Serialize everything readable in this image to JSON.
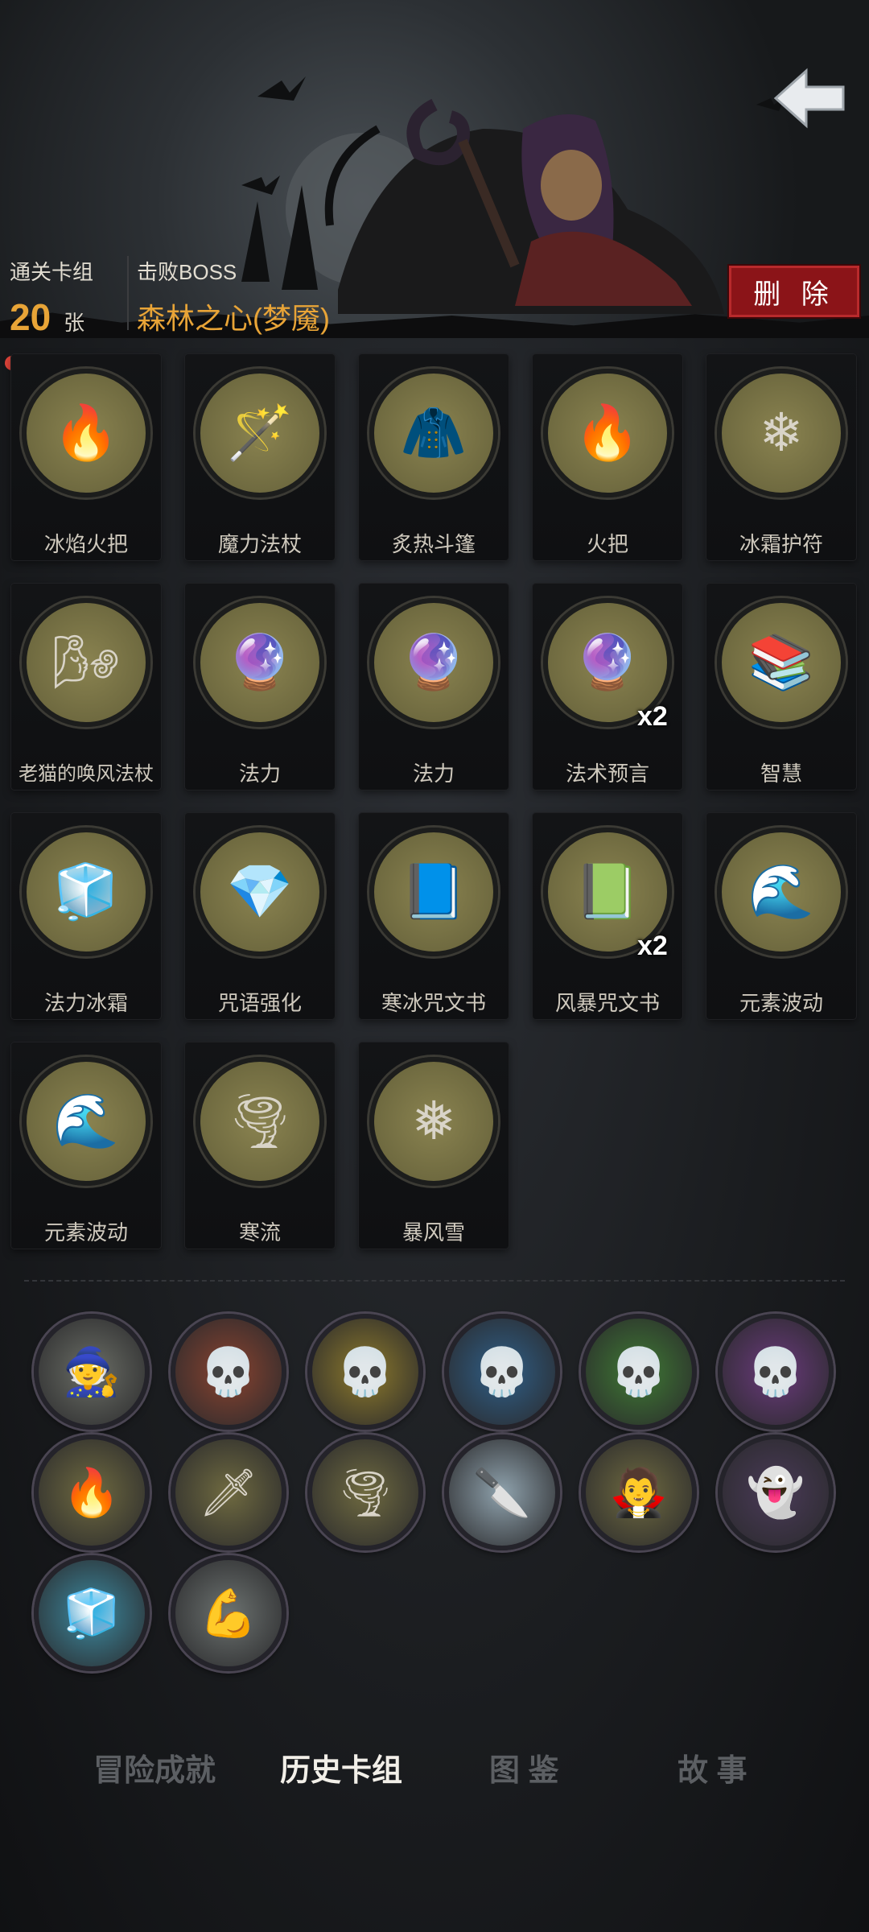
{
  "header": {
    "cleared_deck_label": "通关卡组",
    "card_count": "20",
    "card_unit": "张",
    "defeated_boss_label": "击败BOSS",
    "boss_name": "森林之心(梦魇)",
    "delete_label": "删 除",
    "back_icon": "back-arrow-icon"
  },
  "cards": [
    {
      "name": "冰焰火把",
      "icon": "ice-torch-icon",
      "glyph": "🔥",
      "bg": "#7f7a48"
    },
    {
      "name": "魔力法杖",
      "icon": "magic-staff-icon",
      "glyph": "🪄",
      "bg": "#7f7a48"
    },
    {
      "name": "炙热斗篷",
      "icon": "cloak-icon",
      "glyph": "🧥",
      "bg": "#7f7a48"
    },
    {
      "name": "火把",
      "icon": "torch-icon",
      "glyph": "🔥",
      "bg": "#7f7a48"
    },
    {
      "name": "冰霜护符",
      "icon": "frost-amulet-icon",
      "glyph": "❄",
      "bg": "#7f7a48"
    },
    {
      "name": "老猫的唤风法杖",
      "icon": "wind-staff-icon",
      "glyph": "🌬",
      "bg": "#7f7a48"
    },
    {
      "name": "法力",
      "icon": "mana-orb-icon",
      "glyph": "🔮",
      "bg": "#7f7a48"
    },
    {
      "name": "法力",
      "icon": "mana-orb-icon",
      "glyph": "🔮",
      "bg": "#7f7a48"
    },
    {
      "name": "法术预言",
      "icon": "prophecy-orb-icon",
      "glyph": "🔮",
      "bg": "#7f7a48",
      "multiplier": "x2"
    },
    {
      "name": "智慧",
      "icon": "sage-icon",
      "glyph": "📚",
      "bg": "#7f7a48"
    },
    {
      "name": "法力冰霜",
      "icon": "mana-frost-icon",
      "glyph": "🧊",
      "bg": "#7f7a48"
    },
    {
      "name": "咒语强化",
      "icon": "spell-crystal-icon",
      "glyph": "💎",
      "bg": "#7f7a48"
    },
    {
      "name": "寒冰咒文书",
      "icon": "ice-spellbook-icon",
      "glyph": "📘",
      "bg": "#7f7a48"
    },
    {
      "name": "风暴咒文书",
      "icon": "storm-spellbook-icon",
      "glyph": "📗",
      "bg": "#7f7a48",
      "multiplier": "x2"
    },
    {
      "name": "元素波动",
      "icon": "element-wave-icon",
      "glyph": "🌊",
      "bg": "#7f7a48"
    },
    {
      "name": "元素波动",
      "icon": "element-wave-icon",
      "glyph": "🌊",
      "bg": "#7f7a48"
    },
    {
      "name": "寒流",
      "icon": "cold-wind-icon",
      "glyph": "🌪",
      "bg": "#7f7a48"
    },
    {
      "name": "暴风雪",
      "icon": "blizzard-icon",
      "glyph": "❅",
      "bg": "#7f7a48"
    }
  ],
  "relics": [
    {
      "icon": "old-sage-relic-icon",
      "glyph": "🧙",
      "bg": "#6b6e66"
    },
    {
      "icon": "red-music-skull-relic-icon",
      "glyph": "💀",
      "bg": "#8a4330"
    },
    {
      "icon": "yellow-music-skull-relic-icon",
      "glyph": "💀",
      "bg": "#8d7a2c"
    },
    {
      "icon": "blue-music-skull-relic-icon",
      "glyph": "💀",
      "bg": "#2f5f88"
    },
    {
      "icon": "green-music-skull-relic-icon",
      "glyph": "💀",
      "bg": "#3f7a34"
    },
    {
      "icon": "purple-music-skull-relic-icon",
      "glyph": "💀",
      "bg": "#6a3a7c"
    },
    {
      "icon": "campfire-relic-icon",
      "glyph": "🔥",
      "bg": "#6f6a40"
    },
    {
      "icon": "sword-coins-relic-icon",
      "glyph": "🗡",
      "bg": "#6f6a40"
    },
    {
      "icon": "tornado-relic-icon",
      "glyph": "🌪",
      "bg": "#6f6a40"
    },
    {
      "icon": "dagger-relic-icon",
      "glyph": "🔪",
      "bg": "#8fa2ad"
    },
    {
      "icon": "vampire-relic-icon",
      "glyph": "🧛",
      "bg": "#6f6a40"
    },
    {
      "icon": "haunted-chest-relic-icon",
      "glyph": "👻",
      "bg": "#4a3a58"
    },
    {
      "icon": "ice-prison-relic-icon",
      "glyph": "🧊",
      "bg": "#3c8aa0"
    },
    {
      "icon": "brute-relic-icon",
      "glyph": "💪",
      "bg": "#6c7270"
    }
  ],
  "tabs": [
    {
      "label": "冒险成就",
      "active": false
    },
    {
      "label": "历史卡组",
      "active": true
    },
    {
      "label": "图 鉴",
      "active": false
    },
    {
      "label": "故 事",
      "active": false
    }
  ]
}
